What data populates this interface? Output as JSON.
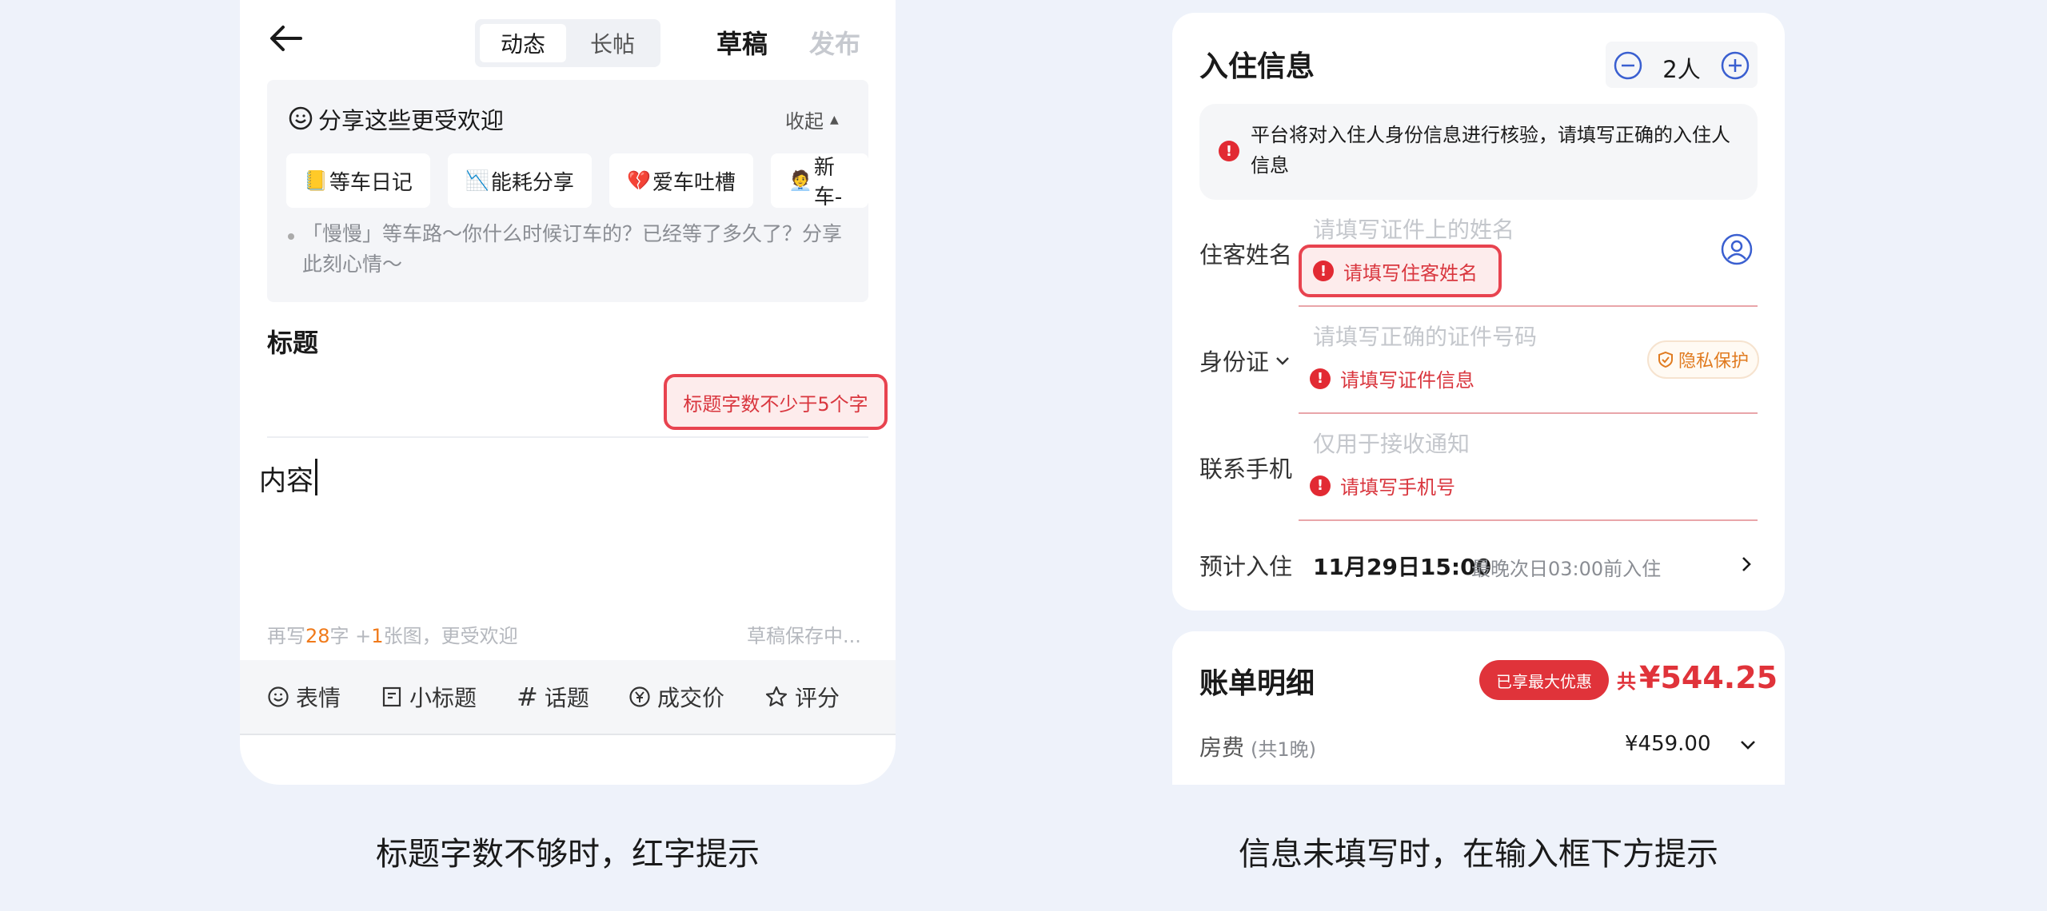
{
  "left": {
    "tabs": [
      "动态",
      "长帖"
    ],
    "draft_label": "草稿",
    "publish_label": "发布",
    "tip_title": "分享这些更受欢迎",
    "collapse_label": "收起",
    "chips": [
      {
        "icon": "📒",
        "label": "等车日记"
      },
      {
        "icon": "📉",
        "label": "能耗分享"
      },
      {
        "icon": "💔",
        "label": "爱车吐槽"
      },
      {
        "icon": "🧑‍💼",
        "label": "新车-"
      }
    ],
    "tip_text": "「慢慢」等车路～你什么时候订车的？已经等了多久了？分享此刻心情～",
    "title_label": "标题",
    "title_error": "标题字数不少于5个字",
    "content_placeholder": "内容",
    "counter": {
      "pre": "再写",
      "chars": "28",
      "mid": "字 +",
      "images": "1",
      "post": "张图，更受欢迎"
    },
    "saving_status": "草稿保存中...",
    "toolbar": [
      {
        "icon": "smile-icon",
        "label": "表情"
      },
      {
        "icon": "subtitle-icon",
        "label": "小标题"
      },
      {
        "icon": "hashtag-icon",
        "label": "话题"
      },
      {
        "icon": "yuan-icon",
        "label": "成交价"
      },
      {
        "icon": "star-icon",
        "label": "评分"
      }
    ],
    "caption": "标题字数不够时，红字提示"
  },
  "right": {
    "section_title": "入住信息",
    "guest_count": "2人",
    "notice": "平台将对入住人身份信息进行核验，请填写正确的入住人信息",
    "fields": [
      {
        "label": "住客姓名",
        "placeholder": "请填写证件上的姓名",
        "error": "请填写住客姓名"
      },
      {
        "label": "身份证",
        "placeholder": "请填写正确的证件号码",
        "error": "请填写证件信息"
      },
      {
        "label": "联系手机",
        "placeholder": "仅用于接收通知",
        "error": "请填写手机号"
      }
    ],
    "privacy_label": "隐私保护",
    "checkin_label": "预计入住",
    "checkin_time": "11月29日15:00",
    "checkin_note": "最晚次日03:00前入住",
    "bill_title": "账单明细",
    "discount_badge": "已享最大优惠",
    "total_prefix": "共",
    "total_amount": "¥544.25",
    "room_fee_label": "房费",
    "room_fee_note": "(共1晚)",
    "room_fee_amount": "¥459.00",
    "caption": "信息未填写时，在输入框下方提示"
  },
  "colors": {
    "background": "#eef2fa",
    "error_red": "#d9363e",
    "accent_blue": "#3a5fd0",
    "counter_orange": "#f07a1a"
  }
}
